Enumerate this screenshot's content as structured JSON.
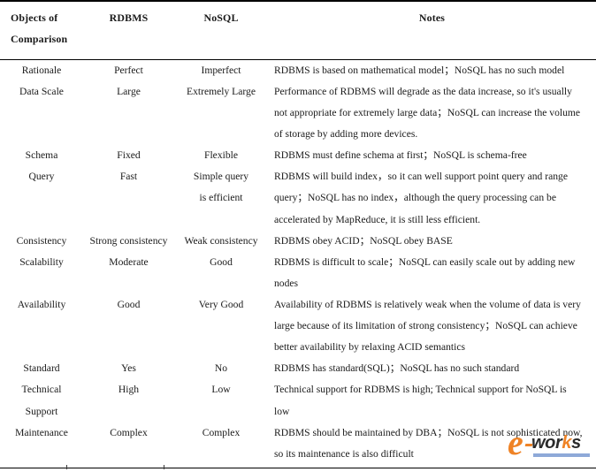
{
  "table": {
    "headers": [
      "Objects of Comparison",
      "RDBMS",
      "NoSQL",
      "Notes"
    ],
    "header_object_line1": "Objects of",
    "header_object_line2": "Comparison",
    "header_rdbms": "RDBMS",
    "header_nosql": "NoSQL",
    "header_notes": "Notes",
    "rows": [
      {
        "object": "Rationale",
        "rdbms": "Perfect",
        "nosql": "Imperfect",
        "nosql_line2": "",
        "notes_lines": [
          "RDBMS is based on mathematical model；NoSQL has no such model"
        ]
      },
      {
        "object": "Data Scale",
        "rdbms": "Large",
        "nosql": "Extremely Large",
        "nosql_line2": "",
        "notes_lines": [
          "Performance of RDBMS will degrade as the data increase, so it's usually",
          "not appropriate for extremely large data；NoSQL can increase the volume",
          "of storage by adding more devices."
        ]
      },
      {
        "object": "Schema",
        "rdbms": "Fixed",
        "nosql": "Flexible",
        "nosql_line2": "",
        "notes_lines": [
          "RDBMS must define schema at first；NoSQL is schema-free"
        ]
      },
      {
        "object": "Query",
        "rdbms": "Fast",
        "nosql": "Simple query",
        "nosql_line2": "is efficient",
        "notes_lines": [
          "RDBMS will build index，so it can well support point query and range",
          "query；NoSQL has no index，although the query processing can be",
          "accelerated by MapReduce, it is still less efficient."
        ]
      },
      {
        "object": "Consistency",
        "rdbms": "Strong consistency",
        "nosql": "Weak consistency",
        "nosql_line2": "",
        "notes_lines": [
          "RDBMS obey ACID；NoSQL obey BASE"
        ]
      },
      {
        "object": "Scalability",
        "rdbms": "Moderate",
        "nosql": "Good",
        "nosql_line2": "",
        "notes_lines": [
          "RDBMS is difficult to scale；NoSQL can easily scale out by adding new",
          "nodes"
        ]
      },
      {
        "object": "Availability",
        "rdbms": "Good",
        "nosql": "Very Good",
        "nosql_line2": "",
        "notes_lines": [
          "Availability of RDBMS is relatively weak when the volume of data is very",
          "large because of its limitation of strong consistency；NoSQL can achieve",
          "better availability by relaxing ACID semantics"
        ]
      },
      {
        "object": "Standard",
        "rdbms": "Yes",
        "nosql": "No",
        "nosql_line2": "",
        "notes_lines": [
          "RDBMS has standard(SQL)；NoSQL has no such standard"
        ]
      },
      {
        "object": "Technical",
        "object_line2": "Support",
        "rdbms": "High",
        "nosql": "Low",
        "nosql_line2": "",
        "notes_lines": [
          "Technical support for RDBMS is high; Technical support for NoSQL is",
          "low"
        ]
      },
      {
        "object": "Maintenance",
        "rdbms": "Complex",
        "nosql": "Complex",
        "nosql_line2": "",
        "notes_lines": [
          "RDBMS should be maintained by DBA；NoSQL is not sophisticated now,",
          "so its maintenance is also difficult"
        ]
      }
    ]
  },
  "watermark": {
    "letter_e": "e",
    "text_wor": "wor",
    "text_k": "k",
    "text_s": "s",
    "full_text": "e-works",
    "accent_color": "#ef8326",
    "bar_color": "#8ea9d8",
    "text_color": "#2b2b2b"
  },
  "bottom_ticks": [
    75,
    185
  ]
}
